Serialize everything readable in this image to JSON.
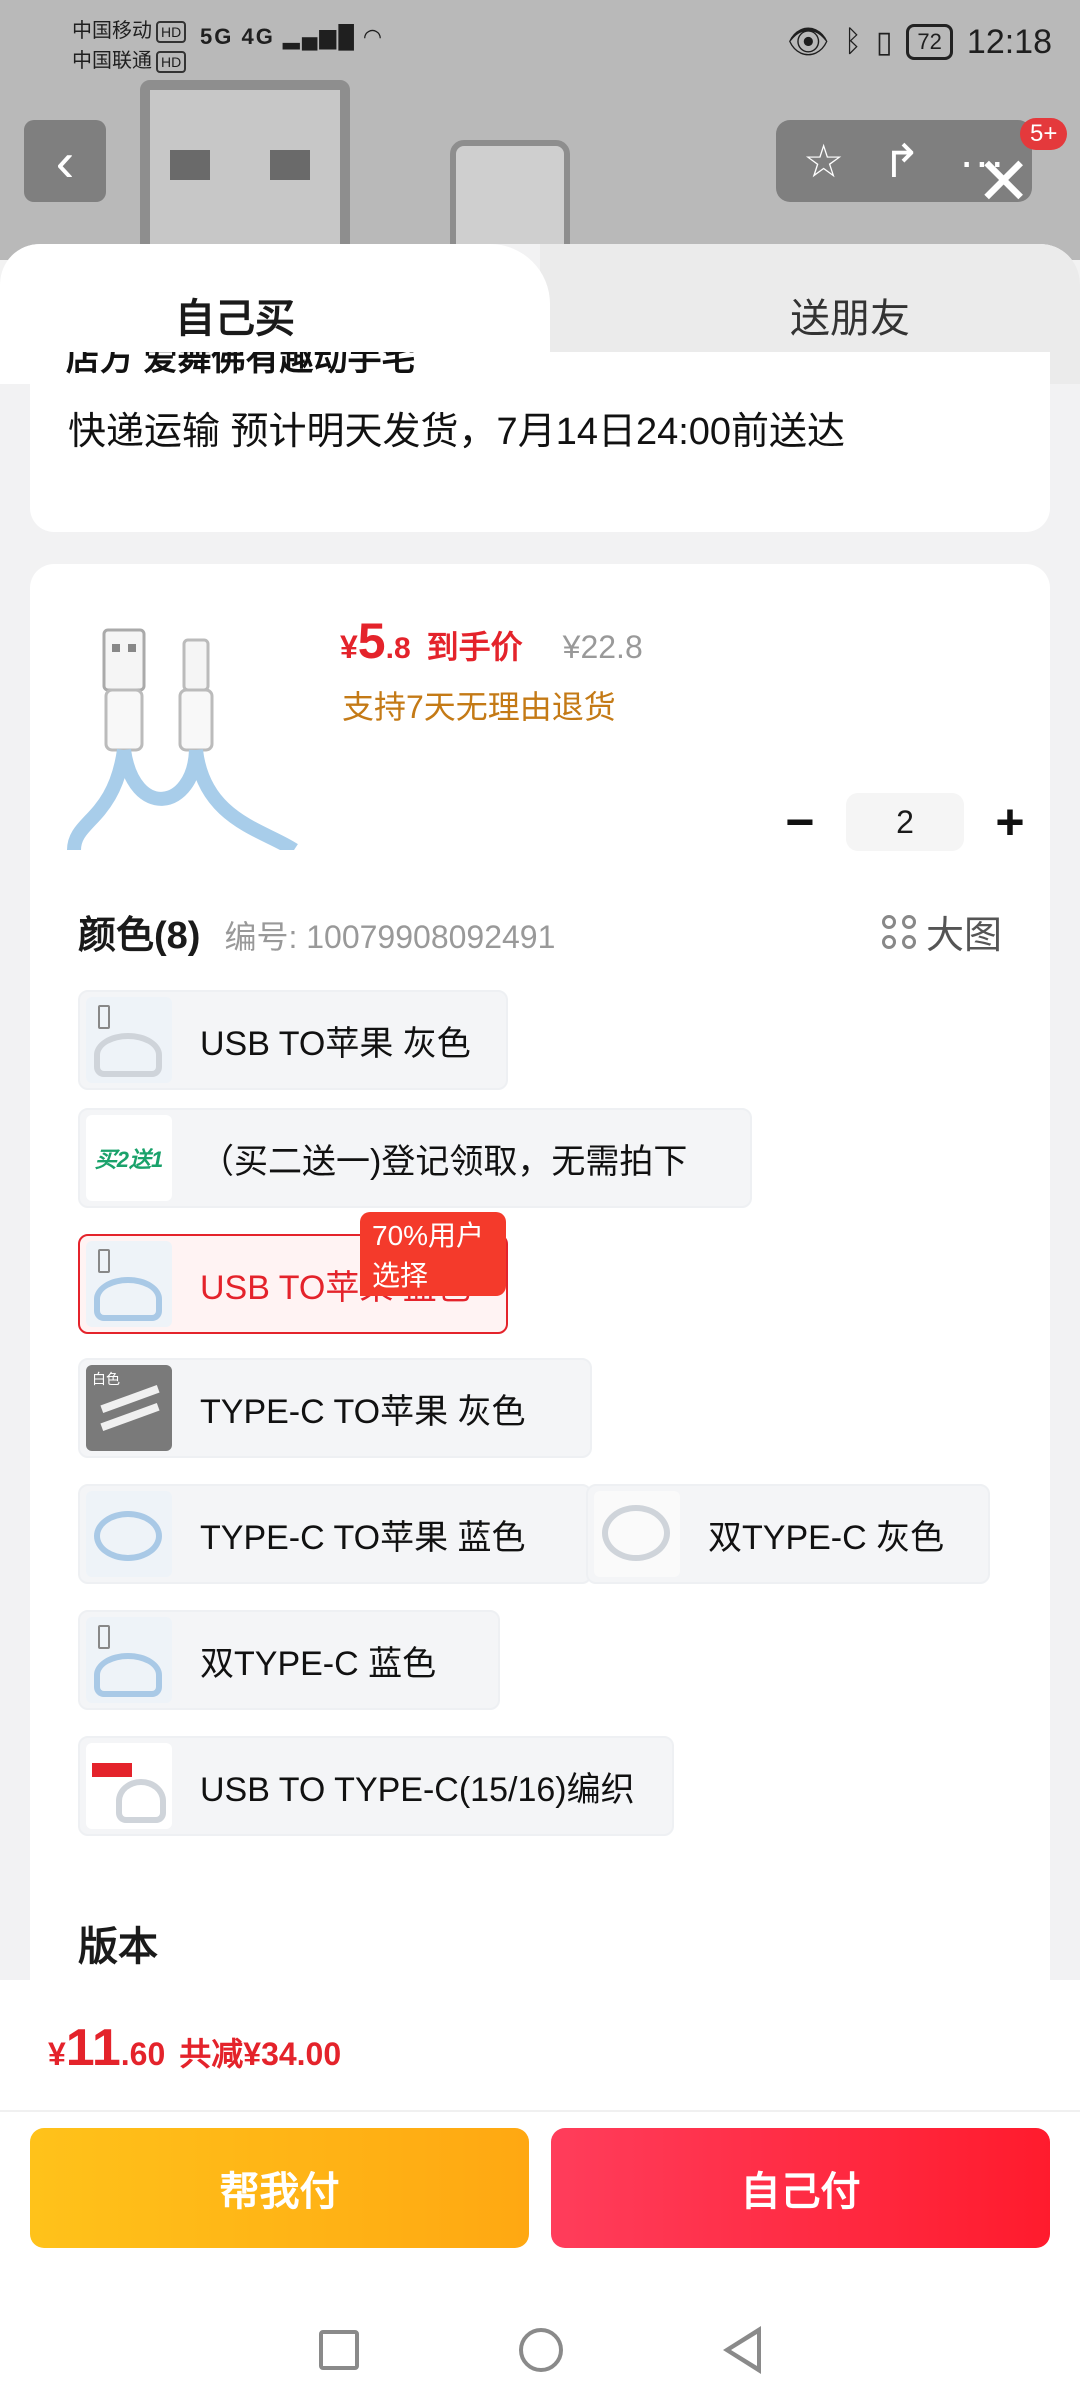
{
  "status_bar": {
    "carrier_1": "中国移动",
    "carrier_2": "中国联通",
    "hd": "HD",
    "signal": "5G 4G",
    "battery": "72",
    "time": "12:18"
  },
  "header": {
    "more_badge": "5+"
  },
  "tabs": {
    "self": "自己买",
    "friend": "送朋友"
  },
  "shipping": {
    "truncated_line": "店方 爱舞佛有趣动手宅",
    "text": "快递运输 预计明天发货，7月14日24:00前送达"
  },
  "product": {
    "price_symbol": "¥",
    "price_int": "5",
    "price_dec": ".8",
    "price_tag": "到手价",
    "original_price": "¥22.8",
    "return_policy": "支持7天无理由退货",
    "quantity": "2"
  },
  "color_section": {
    "title": "颜色(8)",
    "code": "编号: 10079908092491",
    "big_image": "大图",
    "options": [
      {
        "label": "USB TO苹果 灰色"
      },
      {
        "label": "（买二送一)登记领取，无需拍下",
        "thumb_text": "买2送1"
      },
      {
        "label": "USB TO苹果 蓝色",
        "badge": "70%用户选择"
      },
      {
        "label": "TYPE-C TO苹果 灰色",
        "thumb_text": "白色"
      },
      {
        "label": "TYPE-C TO苹果 蓝色"
      },
      {
        "label": "双TYPE-C 灰色"
      },
      {
        "label": "双TYPE-C 蓝色"
      },
      {
        "label": "USB TO TYPE-C(15/16)编织"
      }
    ]
  },
  "version_section": {
    "title": "版本"
  },
  "bottom": {
    "total_symbol": "¥",
    "total_int": "11",
    "total_dec": ".60",
    "reduction": "共减¥34.00",
    "help_pay": "帮我付",
    "self_pay": "自己付"
  },
  "colors": {
    "price_red": "#e4232b",
    "return_orange": "#c47a16",
    "help_yellow": "#ffb414",
    "self_red": "#ff2a40"
  }
}
